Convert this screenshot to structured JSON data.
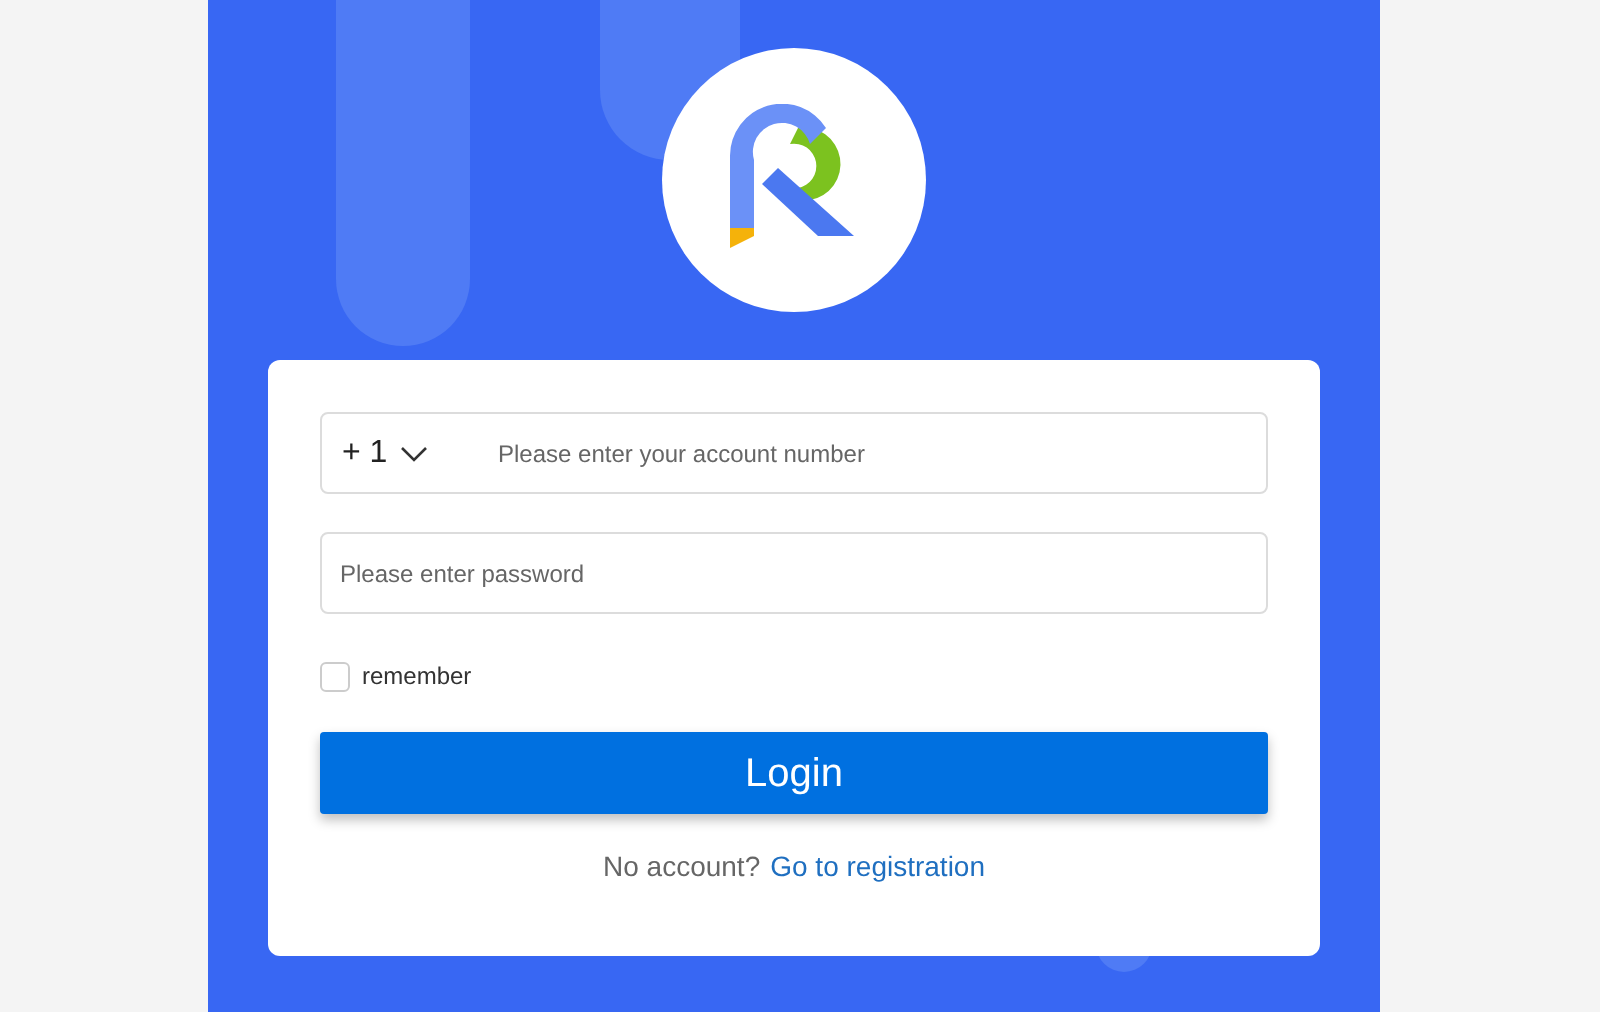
{
  "login_form": {
    "country_code": "+ 1",
    "account_field": {
      "placeholder": "Please enter your account number"
    },
    "password_field": {
      "placeholder": "Please enter password"
    },
    "remember": {
      "label": "remember",
      "checked": false
    },
    "login_button": "Login",
    "register_prompt": {
      "text": "No account?",
      "link": "Go to registration"
    }
  }
}
